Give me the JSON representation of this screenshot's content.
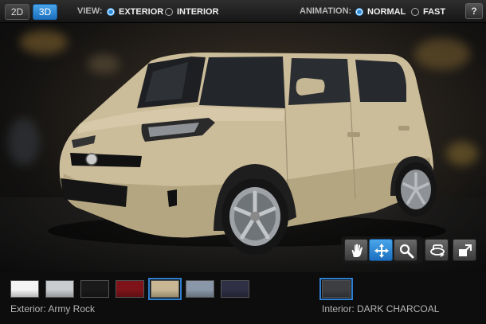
{
  "topbar": {
    "mode_2d": "2D",
    "mode_3d": "3D",
    "view_label": "VIEW:",
    "view_options": [
      "EXTERIOR",
      "INTERIOR"
    ],
    "animation_label": "ANIMATION:",
    "animation_options": [
      "NORMAL",
      "FAST"
    ],
    "help_label": "?"
  },
  "exterior": {
    "caption": "Exterior: Army Rock",
    "swatches": [
      "#f4f4f4",
      "#c9ccce",
      "#1a1a1a",
      "#7e141a",
      "#c9b793",
      "#8a97a8",
      "#2f2f45"
    ],
    "selected_index": 4
  },
  "interior": {
    "caption": "Interior: DARK CHARCOAL",
    "swatches": [
      "#3c3e41"
    ],
    "selected_index": 0
  },
  "controls": [
    "hand-icon",
    "move-icon",
    "zoom-icon",
    "rotate-360-icon",
    "expand-icon"
  ],
  "colors": {
    "accent": "#2d8ee0",
    "car_body": "#cbbc9a"
  }
}
